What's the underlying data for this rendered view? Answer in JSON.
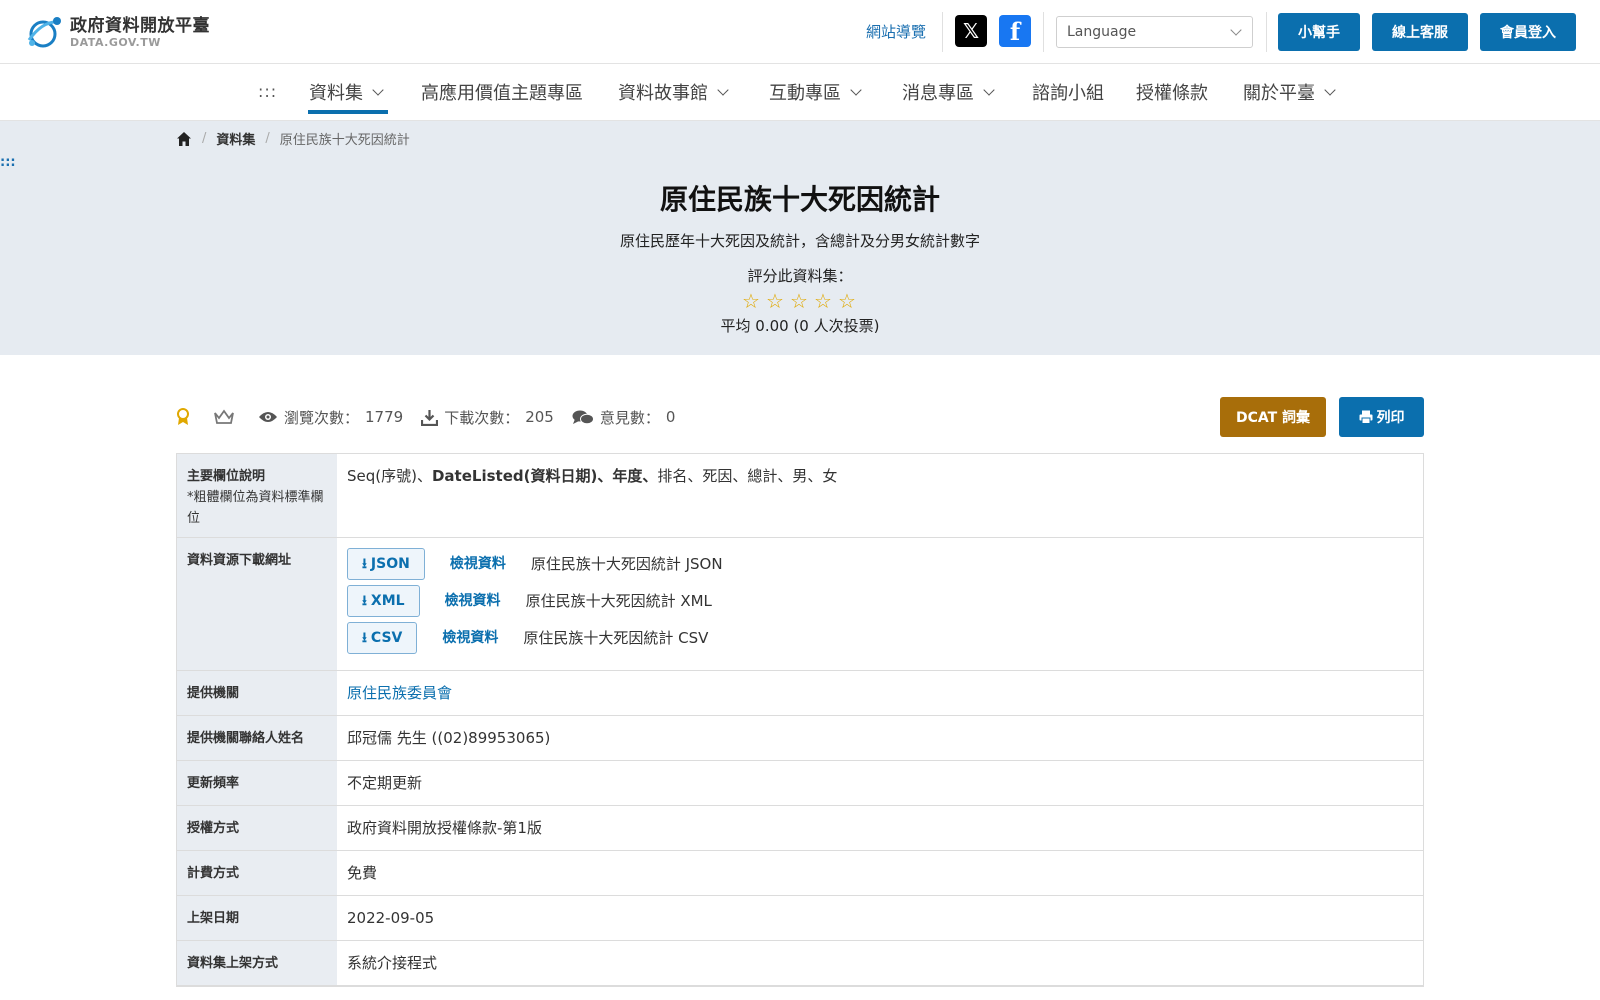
{
  "header": {
    "logo_cn": "政府資料開放平臺",
    "logo_en": "DATA.GOV.TW",
    "site_nav_link": "網站導覽",
    "language_placeholder": "Language",
    "buttons": {
      "helper": "小幫手",
      "support": "線上客服",
      "login": "會員登入"
    }
  },
  "nav": {
    "dots": ":::",
    "items": [
      {
        "label": "資料集",
        "dropdown": true,
        "active": true
      },
      {
        "label": "高應用價值主題專區",
        "dropdown": false
      },
      {
        "label": "資料故事館",
        "dropdown": true
      },
      {
        "label": "互動專區",
        "dropdown": true
      },
      {
        "label": "消息專區",
        "dropdown": true
      },
      {
        "label": "諮詢小組",
        "dropdown": false
      },
      {
        "label": "授權條款",
        "dropdown": false
      },
      {
        "label": "關於平臺",
        "dropdown": true
      }
    ]
  },
  "breadcrumb": {
    "level1": "資料集",
    "current": "原住民族十大死因統計"
  },
  "side_dots": ":::",
  "dataset": {
    "title": "原住民族十大死因統計",
    "description": "原住民歷年十大死因及統計，含總計及分男女統計數字",
    "rating_label": "評分此資料集：",
    "rating_value": 0,
    "rating_avg": "平均 0.00 (0 人次投票)"
  },
  "stats": {
    "views_label": "瀏覽次數：",
    "views": "1779",
    "downloads_label": "下載次數：",
    "downloads": "205",
    "comments_label": "意見數：",
    "comments": "0"
  },
  "actions": {
    "dcat": "DCAT 詞彙",
    "print": "列印"
  },
  "fields": {
    "main_columns": {
      "label": "主要欄位說明",
      "note": "*粗體欄位為資料標準欄位",
      "value_plain1": "Seq(序號)、",
      "value_bold": "DateListed(資料日期)、年度、",
      "value_plain2": "排名、死因、總計、男、女"
    },
    "resources": {
      "label": "資料資源下載網址",
      "view_label": "檢視資料",
      "items": [
        {
          "format": "JSON",
          "name": "原住民族十大死因統計 JSON"
        },
        {
          "format": "XML",
          "name": "原住民族十大死因統計 XML"
        },
        {
          "format": "CSV",
          "name": "原住民族十大死因統計 CSV"
        }
      ]
    },
    "provider": {
      "label": "提供機關",
      "value": "原住民族委員會"
    },
    "contact": {
      "label": "提供機關聯絡人姓名",
      "value": "邱冠儒 先生 ((02)89953065)"
    },
    "frequency": {
      "label": "更新頻率",
      "value": "不定期更新"
    },
    "license": {
      "label": "授權方式",
      "value": "政府資料開放授權條款-第1版"
    },
    "fee": {
      "label": "計費方式",
      "value": "免費"
    },
    "published": {
      "label": "上架日期",
      "value": "2022-09-05"
    },
    "method": {
      "label": "資料集上架方式",
      "value": "系統介接程式"
    }
  },
  "colors": {
    "primary": "#0b6fae",
    "dcat": "#a86e0a",
    "hero_bg": "#e6ebf1",
    "star": "#e0a800"
  }
}
